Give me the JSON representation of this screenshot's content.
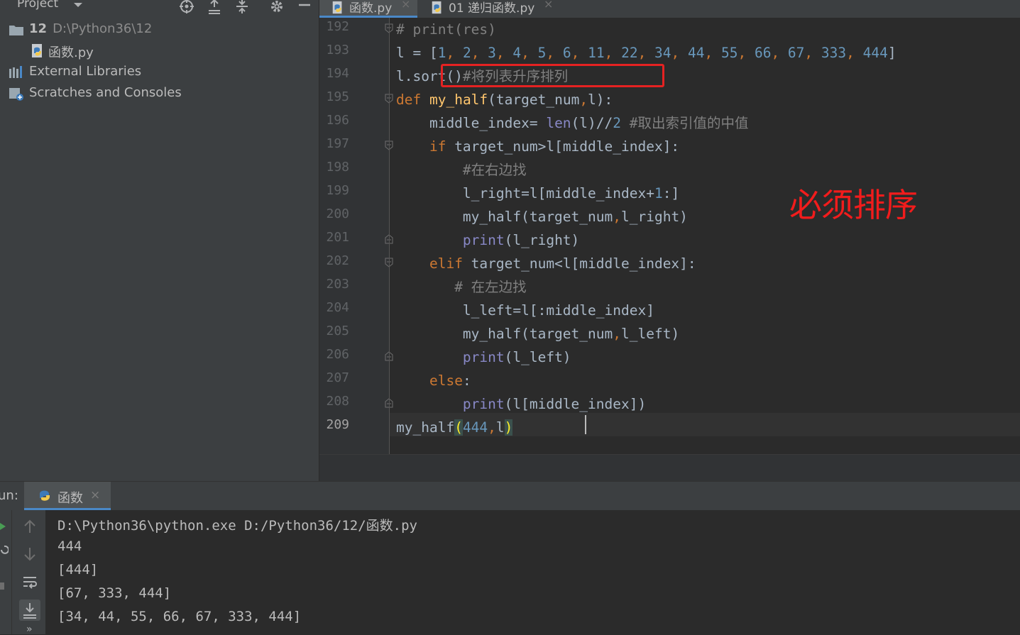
{
  "project_panel": {
    "title": "Project",
    "root": {
      "name": "12",
      "path": "D:\\Python36\\12"
    },
    "items": [
      {
        "label": "函数.py"
      },
      {
        "label": "External Libraries"
      },
      {
        "label": "Scratches and Consoles"
      }
    ]
  },
  "editor": {
    "tabs": [
      {
        "label": "函数.py",
        "active": true
      },
      {
        "label": "01 递归函数.py",
        "active": false
      }
    ],
    "tab_close": "×",
    "line_numbers": [
      "192",
      "193",
      "194",
      "195",
      "196",
      "197",
      "198",
      "199",
      "200",
      "201",
      "202",
      "203",
      "204",
      "205",
      "206",
      "207",
      "208",
      "209"
    ],
    "current_line": "209",
    "annotation": "必须排序"
  },
  "run_panel": {
    "label": "un:",
    "tab_label": "函数",
    "tab_close": "×",
    "output": [
      "D:\\Python36\\python.exe D:/Python36/12/函数.py",
      "444",
      "[444]",
      "[67, 333, 444]",
      "[34, 44, 55, 66, 67, 333, 444]"
    ]
  },
  "colors": {
    "editor_bg": "#2b2b2b",
    "panel_bg": "#3c3f41",
    "keyword": "#cc7832",
    "function": "#ffc66d",
    "builtin": "#8888c6",
    "number": "#6897bb",
    "comment": "#808080",
    "highlight_box": "#e52222",
    "tab_underline": "#4a88c7"
  }
}
